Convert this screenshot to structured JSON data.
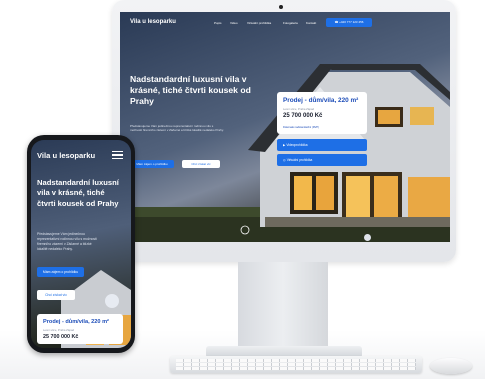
{
  "desktop": {
    "logo": "Vila u lesoparku",
    "nav": [
      "Popis",
      "Video",
      "Virtuální prohlídka",
      "Fotogalerie",
      "Kontakt"
    ],
    "phone_button": "+420 777 123 456",
    "hero_title": "Nadstandardní luxusní vila v krásné, tiché čtvrti kousek od Prahy",
    "hero_text": "Představujeme Vám jedinečnou reprezentativní rodinnou vilu s možností firemního zázemí v Záčarné a blízké lokalitě nedaleko Prahy.",
    "btn_interest": "Mám zájem o prohlídku",
    "btn_more": "Chci získat víc",
    "card": {
      "title": "Prodej - dům/vila, 220 m²",
      "subtitle": "Lesní ulice, Praha Západ",
      "price": "25 700 000 Kč",
      "badge": "Dokonale nadstandardní (RVP)"
    },
    "buttons": [
      "Videoprohlídka",
      "Virtuální prohlídka"
    ]
  },
  "mobile": {
    "logo": "Vila u lesoparku",
    "hero_title": "Nadstandardní luxusní vila v krásné, tiché čtvrti kousek od Prahy",
    "hero_text": "Představujeme Vám jedinečnou reprezentativní rodinnou vilu s možností firemního zázemí v Záčarné a blízké lokalitě nedaleko Prahy.",
    "btn_interest": "Mám zájem o prohlídku",
    "btn_more": "Chci získat víc",
    "card": {
      "title": "Prodej - dům/vila, 220 m²",
      "subtitle": "Lesní ulice, Praha Západ",
      "price": "25 700 000 Kč"
    }
  },
  "colors": {
    "accent": "#1e6fe6",
    "card_title": "#1d4db8"
  }
}
